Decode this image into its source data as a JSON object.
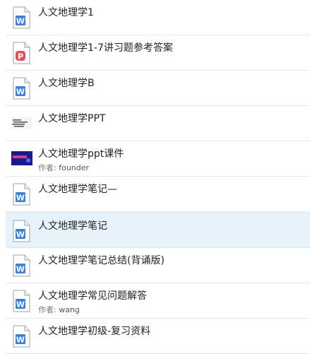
{
  "colors": {
    "word_blue": "#3b7fd8",
    "pdf_red": "#e0525a",
    "selected_bg": "#e8f2fb",
    "divider": "#e6e6e6"
  },
  "author_prefix": "作者:",
  "documents": [
    {
      "title": "人文地理学1",
      "icon": "word-doc-icon",
      "author": ""
    },
    {
      "title": "人文地理学1-7讲习题参考答案",
      "icon": "pdf-doc-icon",
      "author": ""
    },
    {
      "title": "人文地理学B",
      "icon": "word-doc-icon",
      "author": ""
    },
    {
      "title": "人文地理学PPT",
      "icon": "ppt-thumbnail",
      "author": ""
    },
    {
      "title": "人文地理学ppt课件",
      "icon": "ppt-cover-thumbnail",
      "author": "founder"
    },
    {
      "title": "人文地理学笔记—",
      "icon": "word-doc-icon",
      "author": ""
    },
    {
      "title": "人文地理学笔记",
      "icon": "word-doc-icon",
      "author": "",
      "selected": true
    },
    {
      "title": "人文地理学笔记总结(背诵版)",
      "icon": "word-doc-icon",
      "author": ""
    },
    {
      "title": "人文地理学常见问题解答",
      "icon": "word-doc-icon",
      "author": "wang"
    },
    {
      "title": "人文地理学初级-复习资料",
      "icon": "word-doc-icon",
      "author": ""
    }
  ]
}
